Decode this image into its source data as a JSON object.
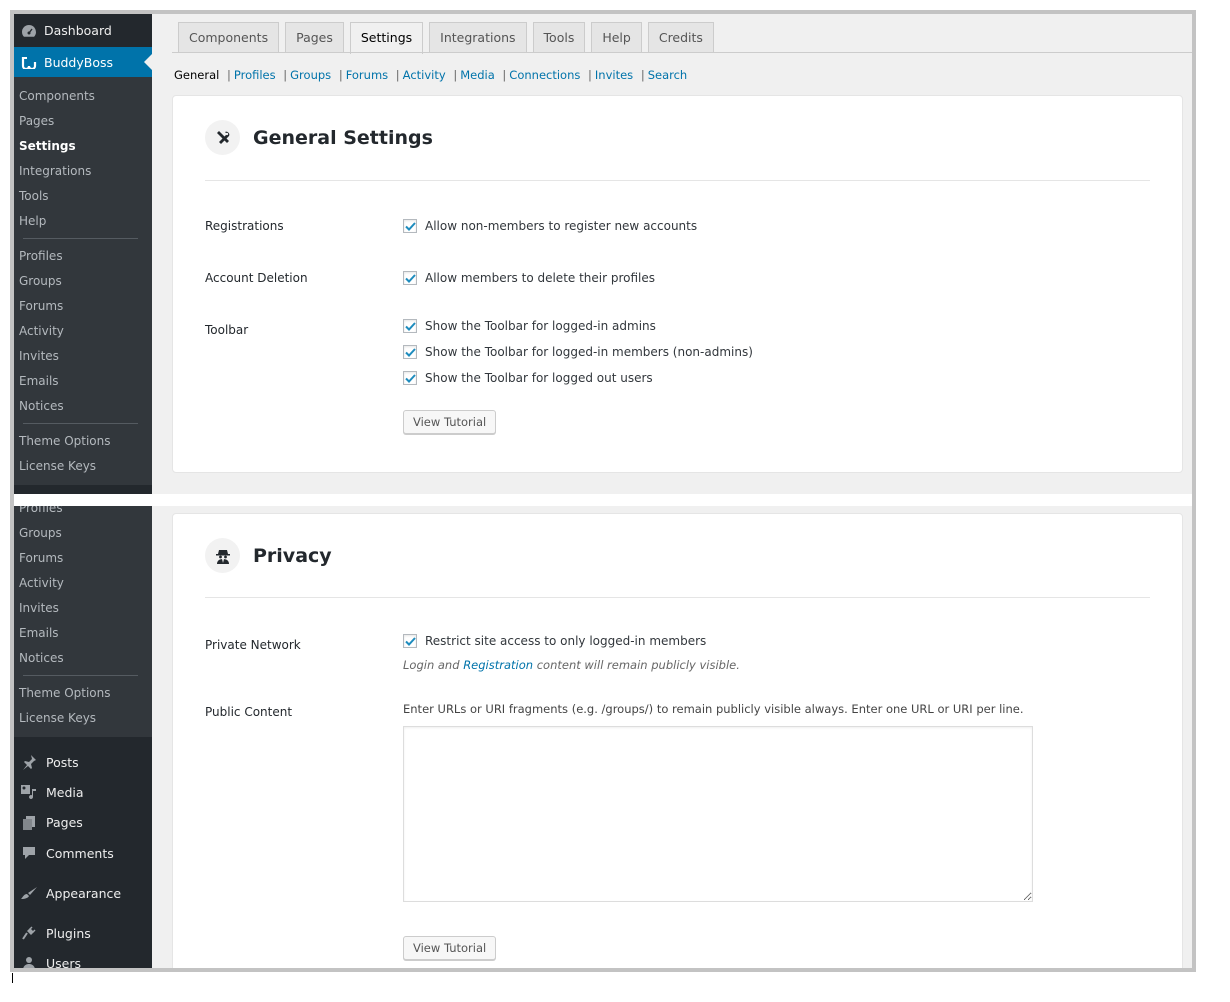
{
  "sidebar_top": {
    "dashboard_label": "Dashboard",
    "buddyboss_label": "BuddyBoss",
    "group1": [
      "Components",
      "Pages",
      "Settings",
      "Integrations",
      "Tools",
      "Help"
    ],
    "group2": [
      "Profiles",
      "Groups",
      "Forums",
      "Activity",
      "Invites",
      "Emails",
      "Notices"
    ],
    "group3": [
      "Theme Options",
      "License Keys"
    ],
    "current_item": "Settings"
  },
  "sidebar_bottom": {
    "group2": [
      "Profiles",
      "Groups",
      "Forums",
      "Activity",
      "Invites",
      "Emails",
      "Notices"
    ],
    "group3": [
      "Theme Options",
      "License Keys"
    ],
    "main_menu": [
      {
        "label": "Posts",
        "icon": "pin-icon"
      },
      {
        "label": "Media",
        "icon": "media-icon"
      },
      {
        "label": "Pages",
        "icon": "pages-icon"
      },
      {
        "label": "Comments",
        "icon": "comment-icon"
      },
      {
        "label": "Appearance",
        "icon": "brush-icon"
      },
      {
        "label": "Plugins",
        "icon": "plug-icon"
      },
      {
        "label": "Users",
        "icon": "user-icon"
      }
    ]
  },
  "tabs": [
    {
      "label": "Components",
      "active": false
    },
    {
      "label": "Pages",
      "active": false
    },
    {
      "label": "Settings",
      "active": true
    },
    {
      "label": "Integrations",
      "active": false
    },
    {
      "label": "Tools",
      "active": false
    },
    {
      "label": "Help",
      "active": false
    },
    {
      "label": "Credits",
      "active": false
    }
  ],
  "subnav": {
    "current": "General",
    "links": [
      "Profiles",
      "Groups",
      "Forums",
      "Activity",
      "Media",
      "Connections",
      "Invites",
      "Search"
    ]
  },
  "general": {
    "title": "General Settings",
    "icon": "tools-icon",
    "registrations_label": "Registrations",
    "registrations_option": "Allow non-members to register new accounts",
    "account_deletion_label": "Account Deletion",
    "account_deletion_option": "Allow members to delete their profiles",
    "toolbar_label": "Toolbar",
    "toolbar_options": [
      "Show the Toolbar for logged-in admins",
      "Show the Toolbar for logged-in members (non-admins)",
      "Show the Toolbar for logged out users"
    ],
    "tutorial_button": "View Tutorial"
  },
  "privacy": {
    "title": "Privacy",
    "icon": "spy-icon",
    "private_network_label": "Private Network",
    "private_network_option": "Restrict site access to only logged-in members",
    "desc_prefix": "Login and ",
    "desc_link": "Registration",
    "desc_suffix": " content will remain publicly visible.",
    "public_content_label": "Public Content",
    "public_content_help": "Enter URLs or URI fragments (e.g. /groups/) to remain publicly visible always. Enter one URL or URI per line.",
    "public_content_value": "",
    "tutorial_button": "View Tutorial"
  },
  "colors": {
    "accent": "#0073aa",
    "sidebar_bg": "#32373c",
    "sidebar_dark": "#23282d"
  }
}
